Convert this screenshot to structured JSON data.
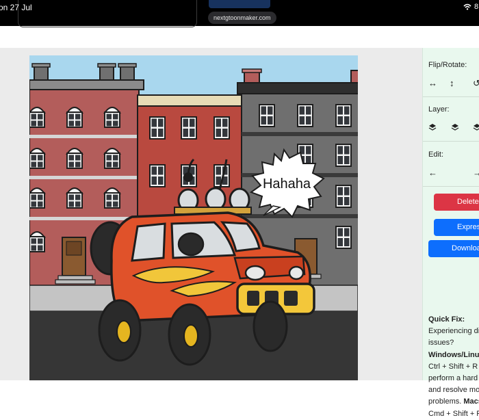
{
  "statusbar": {
    "time_text": "on 27 Jul",
    "url": "nextgtoonmaker.com",
    "battery_fragment": "8"
  },
  "scene": {
    "speech_bubble_text": "Hahaha"
  },
  "panel": {
    "flip_rotate_label": "Flip/Rotate:",
    "layer_label": "Layer:",
    "edit_label": "Edit:",
    "delete_label": "Delete",
    "expression_label": "Expression",
    "download_label": "Download",
    "quick_fix": {
      "title": "Quick Fix:",
      "intro_line1": "Experiencing di",
      "intro_line2": "issues?",
      "windows_heading": "Windows/Linux",
      "windows_line1": "Ctrl + Shift + R",
      "windows_line2": "perform a hard",
      "windows_line3": "and resolve mo",
      "windows_line4": "problems.",
      "mac_heading": "Macs",
      "mac_line1": "Cmd + Shift + R"
    },
    "colors": {
      "background": "#e9f8ee",
      "delete": "#dc3545",
      "expression": "#0d6efd",
      "download": "#0d6efd"
    }
  }
}
